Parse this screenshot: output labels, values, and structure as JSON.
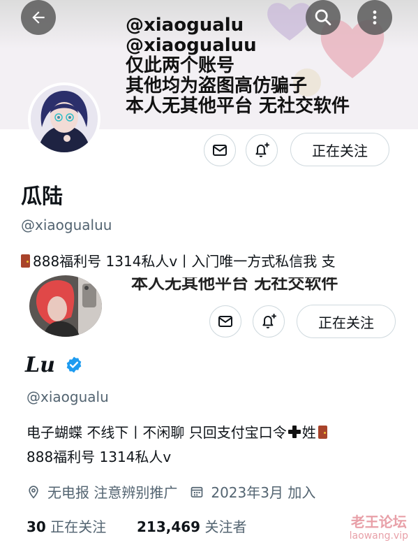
{
  "header": {
    "back_icon": "arrow-left-icon",
    "search_icon": "search-icon",
    "more_icon": "more-vertical-icon",
    "banner_lines": [
      "@xiaogualu",
      "@xiaogualuu",
      "仅此两个账号",
      "其他均为盗图高仿骗子",
      "本人无其他平台 无社交软件"
    ]
  },
  "profile1": {
    "name": "瓜陆",
    "handle": "@xiaogualuu",
    "bio": "888福利号 1314私人v丨入门唯一方式私信我 支",
    "message_icon": "mail-icon",
    "notify_icon": "bell-plus-icon",
    "follow_label": "正在关注"
  },
  "profile2": {
    "banner_text": "本人无其他平台 无社交软件",
    "name": "Lu",
    "verified_icon": "verified-badge-icon",
    "handle": "@xiaogualu",
    "bio_line1_a": "电子蝴蝶 不线下丨不闲聊 只回支付宝口令",
    "bio_line1_b": "姓",
    "bio_line2": "888福利号 1314私人v",
    "message_icon": "mail-icon",
    "notify_icon": "bell-plus-icon",
    "follow_label": "正在关注",
    "location_icon": "location-pin-icon",
    "location": "无电报 注意辨别推广",
    "calendar_icon": "calendar-icon",
    "joined": "2023年3月 加入",
    "following_count": "30",
    "following_label": "正在关注",
    "followers_count": "213,469",
    "followers_label": "关注者"
  },
  "watermark": {
    "title": "老王论坛",
    "site": "laowang.vip"
  },
  "colors": {
    "verified": "#1d9bf0",
    "muted": "#536471",
    "watermark": "#e8a0a8"
  }
}
